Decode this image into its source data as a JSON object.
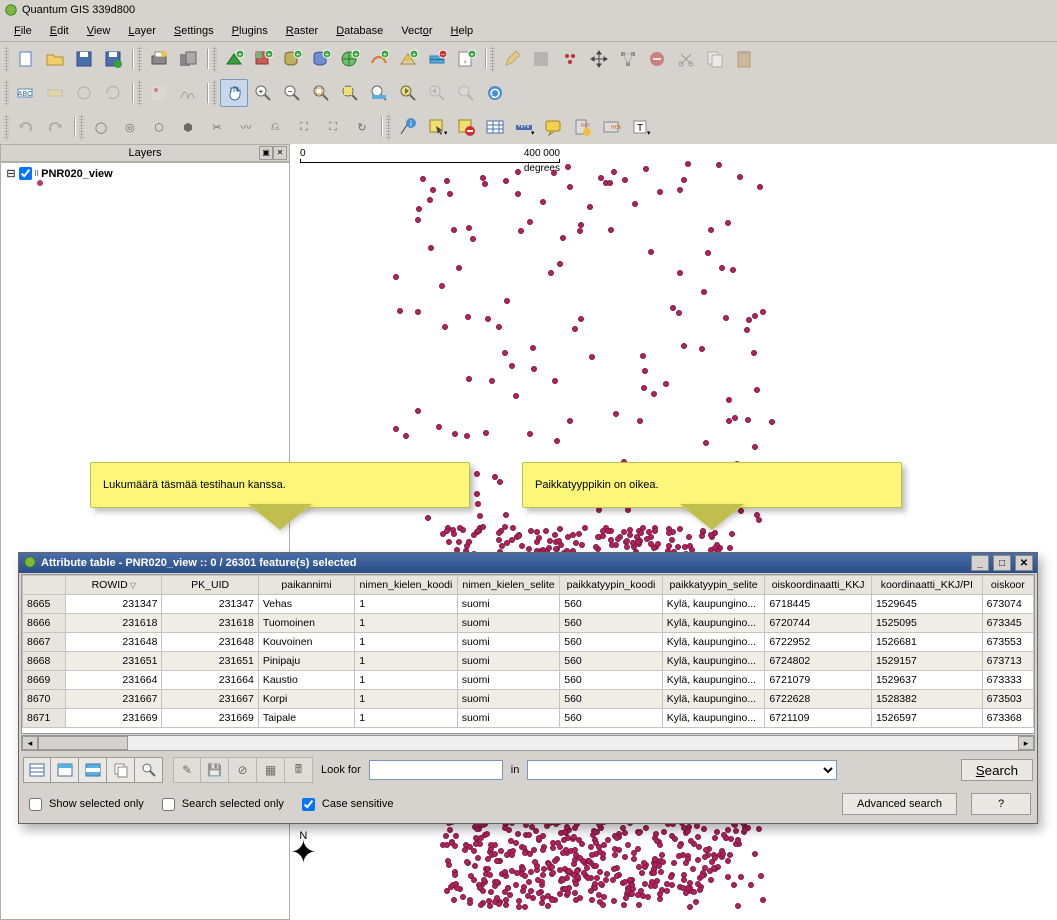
{
  "app": {
    "title": "Quantum GIS 339d800"
  },
  "menu": {
    "file": "File",
    "edit": "Edit",
    "view": "View",
    "layer": "Layer",
    "settings": "Settings",
    "plugins": "Plugins",
    "raster": "Raster",
    "database": "Database",
    "vector": "Vector",
    "help": "Help"
  },
  "layers_panel": {
    "title": "Layers",
    "item": "PNR020_view"
  },
  "scale": {
    "left": "0",
    "right": "400 000",
    "unit": "degrees"
  },
  "callout1": "Lukumäärä täsmää testihaun kanssa.",
  "callout2": "Paikkatyyppikin on oikea.",
  "attr_window": {
    "title": "Attribute table - PNR020_view :: 0 / 26301 feature(s) selected",
    "columns": [
      "",
      "ROWID",
      "PK_UID",
      "paikannimi",
      "nimen_kielen_koodi",
      "nimen_kielen_selite",
      "paikkatyypin_koodi",
      "paikkatyypin_selite",
      "oiskoordinaatti_KKJ",
      "koordinaatti_KKJ/PI",
      "oiskoor"
    ],
    "rows": [
      {
        "n": "8665",
        "rowid": "231347",
        "pk": "231347",
        "nimi": "Vehas",
        "kk": "1",
        "ks": "suomi",
        "pk2": "560",
        "ps": "Kylä, kaupungino...",
        "x": "6718445",
        "y": "1529645",
        "z": "673074"
      },
      {
        "n": "8666",
        "rowid": "231618",
        "pk": "231618",
        "nimi": "Tuomoinen",
        "kk": "1",
        "ks": "suomi",
        "pk2": "560",
        "ps": "Kylä, kaupungino...",
        "x": "6720744",
        "y": "1525095",
        "z": "673345"
      },
      {
        "n": "8667",
        "rowid": "231648",
        "pk": "231648",
        "nimi": "Kouvoinen",
        "kk": "1",
        "ks": "suomi",
        "pk2": "560",
        "ps": "Kylä, kaupungino...",
        "x": "6722952",
        "y": "1526681",
        "z": "673553"
      },
      {
        "n": "8668",
        "rowid": "231651",
        "pk": "231651",
        "nimi": "Pinipaju",
        "kk": "1",
        "ks": "suomi",
        "pk2": "560",
        "ps": "Kylä, kaupungino...",
        "x": "6724802",
        "y": "1529157",
        "z": "673713"
      },
      {
        "n": "8669",
        "rowid": "231664",
        "pk": "231664",
        "nimi": "Kaustio",
        "kk": "1",
        "ks": "suomi",
        "pk2": "560",
        "ps": "Kylä, kaupungino...",
        "x": "6721079",
        "y": "1529637",
        "z": "673333"
      },
      {
        "n": "8670",
        "rowid": "231667",
        "pk": "231667",
        "nimi": "Korpi",
        "kk": "1",
        "ks": "suomi",
        "pk2": "560",
        "ps": "Kylä, kaupungino...",
        "x": "6722628",
        "y": "1528382",
        "z": "673503"
      },
      {
        "n": "8671",
        "rowid": "231669",
        "pk": "231669",
        "nimi": "Taipale",
        "kk": "1",
        "ks": "suomi",
        "pk2": "560",
        "ps": "Kylä, kaupungino...",
        "x": "6721109",
        "y": "1526597",
        "z": "673368"
      }
    ],
    "lookfor_label": "Look for",
    "in_label": "in",
    "search_btn": "Search",
    "show_selected": "Show selected only",
    "search_selected": "Search selected only",
    "case_sensitive": "Case sensitive",
    "advanced": "Advanced search",
    "help": "?"
  },
  "compass": "N"
}
